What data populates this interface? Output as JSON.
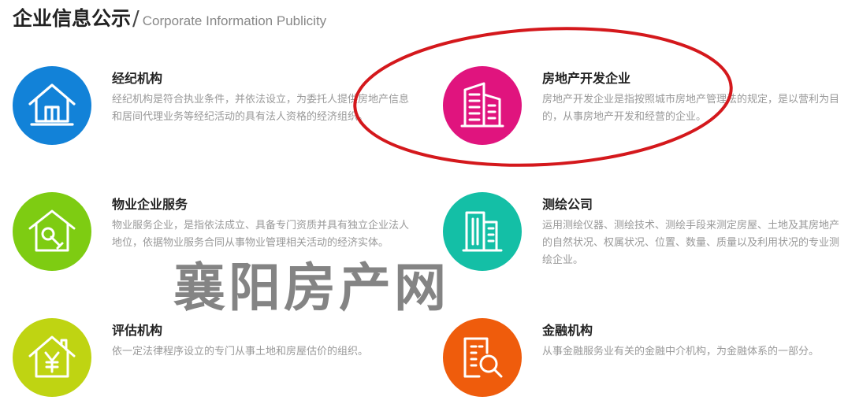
{
  "header": {
    "title": "企业信息公示",
    "separator": "/",
    "subtitle": "Corporate Information Publicity"
  },
  "items": [
    {
      "name": "经纪机构",
      "description": "经纪机构是符合执业条件，并依法设立，为委托人提供房地产信息和居间代理业务等经纪活动的具有法人资格的经济组织。",
      "icon": "house-icon",
      "color": "#1282d8"
    },
    {
      "name": "房地产开发企业",
      "description": "房地产开发企业是指按照城市房地产管理法的规定，是以营利为目的，从事房地产开发和经营的企业。",
      "icon": "buildings-icon",
      "color": "#e0147e"
    },
    {
      "name": "物业企业服务",
      "description": "物业服务企业，是指依法成立、具备专门资质并具有独立企业法人地位，依据物业服务合同从事物业管理相关活动的经济实体。",
      "icon": "house-wrench-icon",
      "color": "#7ecc12"
    },
    {
      "name": "测绘公司",
      "description": "运用测绘仪器、测绘技术、测绘手段来测定房屋、土地及其房地产的自然状况、权属状况、位置、数量、质量以及利用状况的专业测绘企业。",
      "icon": "building-survey-icon",
      "color": "#14bfa6"
    },
    {
      "name": "评估机构",
      "description": "依一定法律程序设立的专门从事土地和房屋估价的组织。",
      "icon": "house-yen-icon",
      "color": "#bfd412"
    },
    {
      "name": "金融机构",
      "description": "从事金融服务业有关的金融中介机构，为金融体系的一部分。",
      "icon": "building-search-icon",
      "color": "#ef5c0c"
    }
  ],
  "watermark": "襄阳房产网",
  "annotation_color": "#d4181c"
}
